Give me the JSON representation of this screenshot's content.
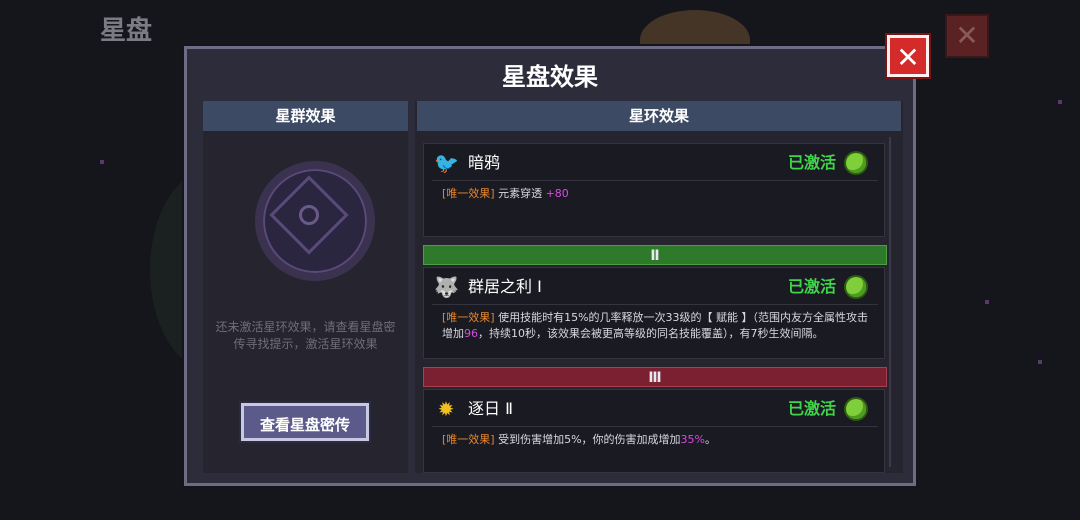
{
  "background": {
    "title": "星盘",
    "close_glyph": "✕"
  },
  "modal": {
    "title": "星盘效果",
    "close_glyph": "✕"
  },
  "left": {
    "header": "星群效果",
    "hint": "还未激活星环效果，请查看星盘密传寻找提示，激活星环效果",
    "button": "查看星盘密传"
  },
  "right": {
    "header": "星环效果",
    "entries": [
      {
        "icon": "raven-icon",
        "icon_glyph": "🐦",
        "name": "暗鸦",
        "status": "已激活",
        "tag": "[唯一效果]",
        "desc_a": "元素穿透 ",
        "num1": "+80",
        "desc_b": "",
        "num2": "",
        "desc_c": ""
      },
      {
        "icon": "wolf-icon",
        "icon_glyph": "🐺",
        "name": "群居之利 Ⅰ",
        "status": "已激活",
        "tag": "[唯一效果]",
        "desc_a": "使用技能时有15%的几率释放一次33级的【 赋能 】（范围内友方全属性攻击增加",
        "num1": "96",
        "desc_b": "，持续10秒，该效果会被更高等级的同名技能覆盖），有7秒生效间隔。",
        "num2": "",
        "desc_c": ""
      },
      {
        "icon": "sun-icon",
        "icon_glyph": "✹",
        "name": "逐日 Ⅱ",
        "status": "已激活",
        "tag": "[唯一效果]",
        "desc_a": "受到伤害增加5%，你的伤害加成增加",
        "num1": "35%",
        "desc_b": "。",
        "num2": "",
        "desc_c": ""
      }
    ],
    "tiers": [
      "Ⅱ",
      "Ⅲ"
    ]
  },
  "colors": {
    "active_green": "#3fd44a",
    "tag_orange": "#e8862a",
    "value_purple": "#d84adf",
    "tier2_green": "#2f7a2a",
    "tier3_red": "#7a2030"
  }
}
